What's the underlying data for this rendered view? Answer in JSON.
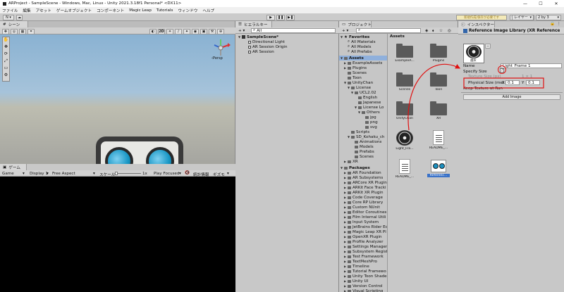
{
  "window": {
    "title": "ARProject - SampleScene - Windows, Mac, Linux - Unity 2021.3.18f1 Personal* <DX11>",
    "min": "—",
    "max": "☐",
    "close": "✕"
  },
  "menu": [
    "ファイル",
    "編集",
    "アセット",
    "ゲームオブジェクト",
    "コンポーネント",
    "Magic Leap",
    "Tutorials",
    "ウィンドウ",
    "ヘルプ"
  ],
  "toolbar": {
    "account": "N",
    "cloud": "☁",
    "play": "▶",
    "pause": "❚❚",
    "step": "▶❚",
    "notice": "新規作成/保存が必要です",
    "layers": "レイヤー",
    "layout": "2 by 3"
  },
  "scene": {
    "tab": "シーン",
    "tools": [
      "✋",
      "✥",
      "⟳",
      "⤢",
      "▭",
      "⚙"
    ],
    "persp": "‹Persp",
    "btn_2d": "2D"
  },
  "game": {
    "tab": "ゲーム",
    "mode": "Game",
    "display": "Display 1",
    "aspect": "Free Aspect",
    "scale_label": "スケール",
    "scale_value": "1x",
    "play_focus": "Play Focused",
    "mute": "🔇",
    "stats": "統計情報",
    "gizmos": "ギズモ"
  },
  "hierarchy": {
    "tab": "ヒエラルキー",
    "add": "+ ▾",
    "search": "All",
    "scene": "SampleScene*",
    "items": [
      "Directional Light",
      "AR Session Origin",
      "AR Session"
    ]
  },
  "project": {
    "tab": "プロジェクト",
    "favorites_label": "Favorites",
    "favorites": [
      "All Materials",
      "All Models",
      "All Prefabs"
    ],
    "assets_label": "Assets",
    "assets_tree": [
      {
        "label": "ExampleAssets",
        "depth": 1,
        "arrow": "▶"
      },
      {
        "label": "Plugins",
        "depth": 1,
        "arrow": "▶"
      },
      {
        "label": "Scenes",
        "depth": 1,
        "arrow": ""
      },
      {
        "label": "Toon",
        "depth": 1,
        "arrow": ""
      },
      {
        "label": "UnityChan",
        "depth": 1,
        "arrow": "▼"
      },
      {
        "label": "License",
        "depth": 2,
        "arrow": "▼"
      },
      {
        "label": "UCL2.02",
        "depth": 3,
        "arrow": "▼"
      },
      {
        "label": "English",
        "depth": 4,
        "arrow": ""
      },
      {
        "label": "Japanese",
        "depth": 4,
        "arrow": ""
      },
      {
        "label": "License Lo",
        "depth": 4,
        "arrow": "▼"
      },
      {
        "label": "Others",
        "depth": 5,
        "arrow": "▼"
      },
      {
        "label": "jpg",
        "depth": 6,
        "arrow": ""
      },
      {
        "label": "png",
        "depth": 6,
        "arrow": ""
      },
      {
        "label": "svg",
        "depth": 6,
        "arrow": ""
      },
      {
        "label": "Scripts",
        "depth": 2,
        "arrow": ""
      },
      {
        "label": "SD_Kohaku_ch",
        "depth": 2,
        "arrow": "▼"
      },
      {
        "label": "Animations",
        "depth": 3,
        "arrow": ""
      },
      {
        "label": "Models",
        "depth": 3,
        "arrow": ""
      },
      {
        "label": "Prefabs",
        "depth": 3,
        "arrow": ""
      },
      {
        "label": "Scenes",
        "depth": 3,
        "arrow": ""
      },
      {
        "label": "XR",
        "depth": 1,
        "arrow": "▶"
      }
    ],
    "packages_label": "Packages",
    "packages": [
      "AR Foundation",
      "AR Subsystems",
      "ARCore XR Plugin",
      "ARKit Face Tracki",
      "ARKit XR Plugin",
      "Code Coverage",
      "Core RP Library",
      "Custom NUnit",
      "Editor Coroutines",
      "Film Internal Utili",
      "Input System",
      "JetBrains Rider Ec",
      "Magic Leap XR Pl",
      "OpenXR Plugin",
      "Profile Analyzer",
      "Settings Manager",
      "Subsystem Regist",
      "Test Framework",
      "TextMeshPro",
      "Timeline",
      "Tutorial Framewo",
      "Unity Toon Shade",
      "Unity UI",
      "Version Control",
      "Visual Scripting",
      "Visual Studio Cod",
      "Visual Studio Edi"
    ],
    "grid_header": "Assets",
    "grid": [
      {
        "label": "ExampleA...",
        "type": "folder"
      },
      {
        "label": "Plugins",
        "type": "folder"
      },
      {
        "label": "Scenes",
        "type": "folder"
      },
      {
        "label": "Toon",
        "type": "folder"
      },
      {
        "label": "UnityChan",
        "type": "folder"
      },
      {
        "label": "XR",
        "type": "folder"
      },
      {
        "label": "Light_Fra...",
        "type": "image"
      },
      {
        "label": "README_...",
        "type": "doc"
      },
      {
        "label": "README_...",
        "type": "doc"
      },
      {
        "label": "Referenc...",
        "type": "library"
      }
    ]
  },
  "inspector": {
    "tab": "インスペクター",
    "title": "Reference Image Library (XR Reference",
    "thumb_caption": "選択",
    "remove": "−",
    "name_label": "Name",
    "name_value": "Light_Frame 1",
    "specify_label": "Specify Size",
    "texture_label": "Texture Size (px)",
    "texture_value": "1 × 1",
    "physical_label": "Physical Size (met",
    "x_label": "X",
    "x_value": "0.1",
    "y_label": "Y",
    "y_value": "0.1",
    "keep_label": "Keep Texture at Run",
    "add_image": "Add Image"
  },
  "colors": {
    "annotation": "#e01010",
    "selection": "#3a72c8"
  }
}
